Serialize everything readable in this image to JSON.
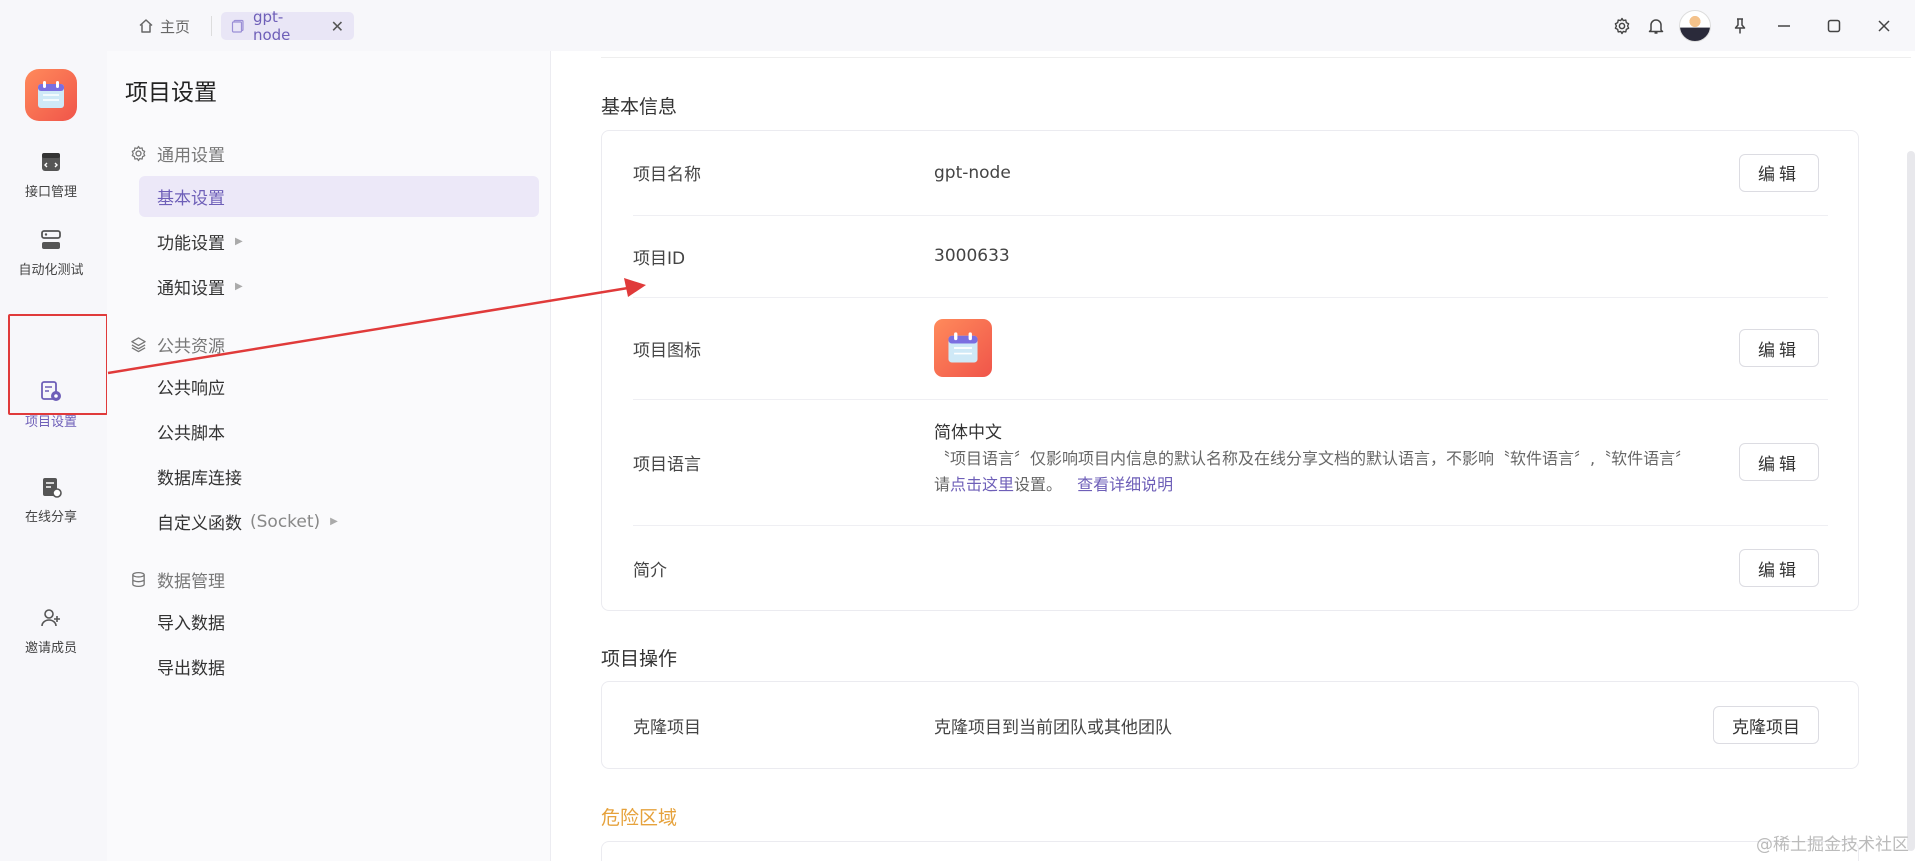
{
  "tabs": {
    "home": "主页",
    "project": "gpt-node",
    "close": "✕"
  },
  "leftnav": {
    "items": [
      {
        "label": "接口管理",
        "icon": "api-icon"
      },
      {
        "label": "自动化测试",
        "icon": "automation-icon"
      },
      {
        "label": "项目设置",
        "icon": "project-settings-icon",
        "active": true
      },
      {
        "label": "在线分享",
        "icon": "share-icon"
      },
      {
        "label": "邀请成员",
        "icon": "add-user-icon"
      }
    ]
  },
  "menu": {
    "title": "项目设置",
    "groups": [
      {
        "label": "通用设置",
        "icon": "gear-icon"
      },
      {
        "label": "公共资源",
        "icon": "layers-icon"
      },
      {
        "label": "数据管理",
        "icon": "database-icon"
      }
    ],
    "items": {
      "basic": "基本设置",
      "function": "功能设置",
      "notify": "通知设置",
      "public_response": "公共响应",
      "public_script": "公共脚本",
      "db_connect": "数据库连接",
      "custom_func": "自定义函数",
      "custom_func_sub": "(Socket)",
      "import": "导入数据",
      "export": "导出数据"
    }
  },
  "basic_info": {
    "title": "基本信息",
    "name_label": "项目名称",
    "name_value": "gpt-node",
    "id_label": "项目ID",
    "id_value": "3000633",
    "icon_label": "项目图标",
    "lang_label": "项目语言",
    "lang_value": "简体中文",
    "lang_desc_1": "〝项目语言〞仅影响项目内信息的默认名称及在线分享文档的默认语言，不影响〝软件语言〞,〝软件语言〞 请",
    "lang_link_1": "点击这里",
    "lang_desc_2": "设置。",
    "lang_link_2": "查看详细说明",
    "intro_label": "简介",
    "edit_label": "编辑"
  },
  "project_ops": {
    "title": "项目操作",
    "clone_label": "克隆项目",
    "clone_desc": "克隆项目到当前团队或其他团队",
    "clone_button": "克隆项目"
  },
  "danger": {
    "title": "危险区域"
  },
  "watermark": "@稀土掘金技术社区",
  "colors": {
    "accent": "#6e5fb8",
    "danger": "#e6a23c",
    "annotation": "#e03a3a",
    "logo": "#f0554a"
  }
}
